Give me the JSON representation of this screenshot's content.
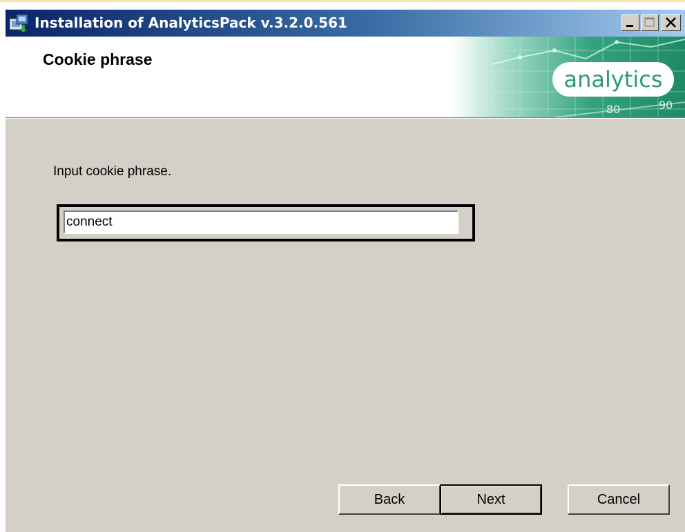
{
  "window": {
    "title": "Installation of AnalyticsPack v.3.2.0.561"
  },
  "header": {
    "title": "Cookie phrase",
    "banner_label": "analytics",
    "banner_numbers": [
      "80",
      "90"
    ]
  },
  "body": {
    "prompt": "Input cookie phrase.",
    "cookie_field": {
      "value": "connect"
    }
  },
  "buttons": {
    "back": "Back",
    "next": "Next",
    "cancel": "Cancel"
  },
  "colors": {
    "titlebar": "#0a246a",
    "dialog_face": "#d4d0c8",
    "brand_green": "#2c9a78"
  }
}
